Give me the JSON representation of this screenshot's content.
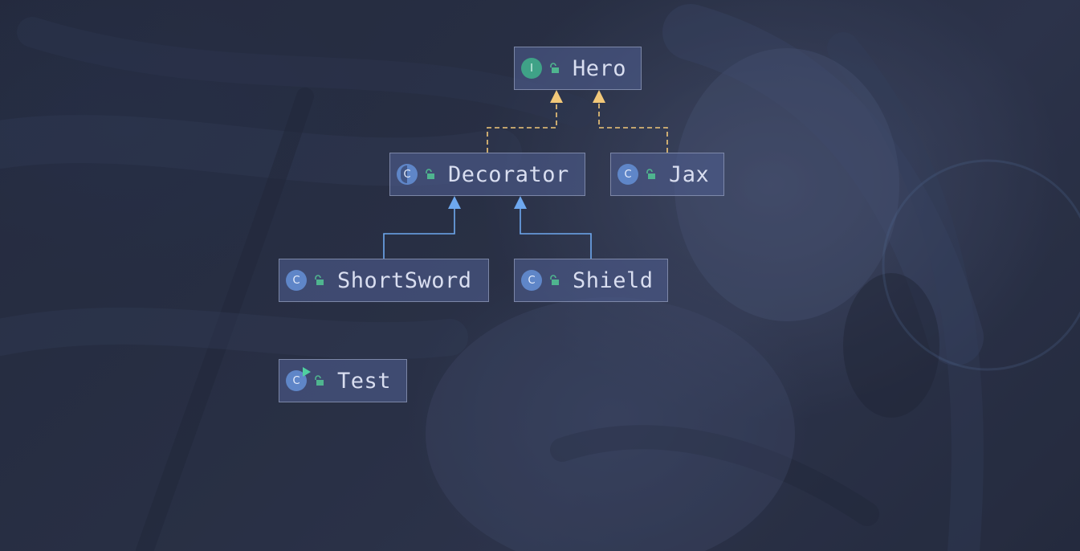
{
  "diagram": {
    "nodes": [
      {
        "id": "hero",
        "label": "Hero",
        "kind": "interface",
        "badge": "I",
        "visibility": "public"
      },
      {
        "id": "decorator",
        "label": "Decorator",
        "kind": "abstract-class",
        "badge": "C",
        "visibility": "public"
      },
      {
        "id": "jax",
        "label": "Jax",
        "kind": "class",
        "badge": "C",
        "visibility": "public"
      },
      {
        "id": "shortsword",
        "label": "ShortSword",
        "kind": "class",
        "badge": "C",
        "visibility": "public"
      },
      {
        "id": "shield",
        "label": "Shield",
        "kind": "class",
        "badge": "C",
        "visibility": "public"
      },
      {
        "id": "test",
        "label": "Test",
        "kind": "runnable-class",
        "badge": "C",
        "visibility": "public"
      }
    ],
    "edges": [
      {
        "from": "decorator",
        "to": "hero",
        "type": "implements"
      },
      {
        "from": "jax",
        "to": "hero",
        "type": "implements"
      },
      {
        "from": "shortsword",
        "to": "decorator",
        "type": "extends"
      },
      {
        "from": "shield",
        "to": "decorator",
        "type": "extends"
      }
    ],
    "colors": {
      "implements": "#f2c879",
      "extends": "#6ea8ef",
      "interface_badge": "#3fa287",
      "class_badge": "#5f86c8",
      "lock": "#4fb58f",
      "run_marker": "#4fd1a0",
      "node_fill": "#4e5c8c",
      "label": "#d9def0"
    },
    "icons": {
      "badge": "class-kind-icon",
      "visibility": "unlocked-padlock-icon",
      "run": "run-triangle-icon"
    }
  }
}
